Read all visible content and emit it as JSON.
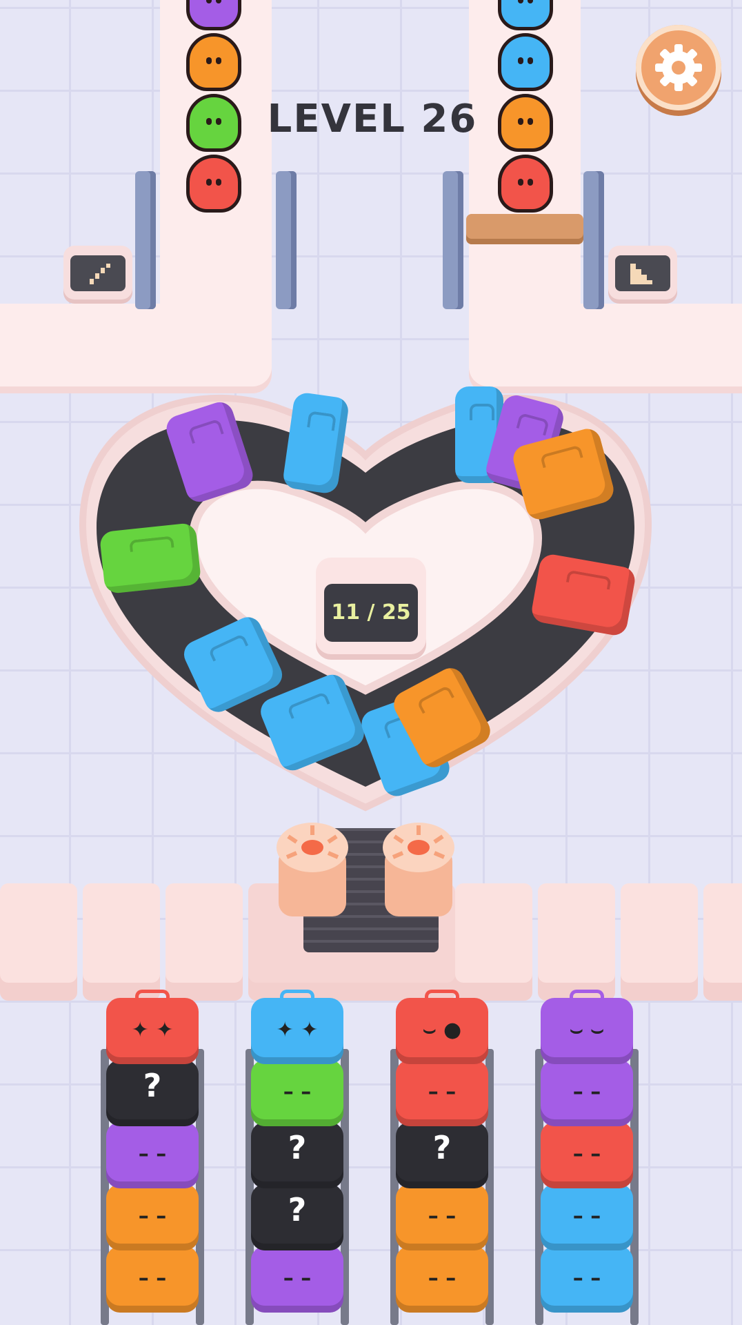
{
  "hud": {
    "level_title": "LEVEL 26",
    "settings_icon": "gear-icon"
  },
  "carousel": {
    "shape": "heart",
    "progress_text": "11 / 25",
    "progress": {
      "current": 11,
      "total": 25
    },
    "bags_on_belt": [
      "purple",
      "blue",
      "blue",
      "purple",
      "orange",
      "green",
      "red",
      "blue",
      "blue",
      "blue",
      "orange"
    ]
  },
  "queues": {
    "left": [
      "purple",
      "orange",
      "green",
      "red"
    ],
    "right": [
      "blue",
      "blue",
      "orange",
      "red"
    ]
  },
  "lanes": [
    {
      "bags": [
        {
          "color": "red",
          "face": "angry"
        },
        {
          "color": "black",
          "face": "?"
        },
        {
          "color": "purple",
          "face": "– –"
        },
        {
          "color": "orange",
          "face": "– –"
        },
        {
          "color": "orange",
          "face": "– –"
        }
      ]
    },
    {
      "bags": [
        {
          "color": "blue",
          "face": "angry"
        },
        {
          "color": "green",
          "face": "– –"
        },
        {
          "color": "black",
          "face": "?"
        },
        {
          "color": "black",
          "face": "?"
        },
        {
          "color": "purple",
          "face": "– –"
        }
      ]
    },
    {
      "bags": [
        {
          "color": "red",
          "face": "wink"
        },
        {
          "color": "red",
          "face": "– –"
        },
        {
          "color": "black",
          "face": "?"
        },
        {
          "color": "orange",
          "face": "– –"
        },
        {
          "color": "orange",
          "face": "– –"
        }
      ]
    },
    {
      "bags": [
        {
          "color": "purple",
          "face": "smile"
        },
        {
          "color": "purple",
          "face": "– –"
        },
        {
          "color": "red",
          "face": "– –"
        },
        {
          "color": "blue",
          "face": "– –"
        },
        {
          "color": "blue",
          "face": "– –"
        }
      ]
    }
  ],
  "palette": {
    "red": "#f2544a",
    "blue": "#45b5f5",
    "green": "#66d43f",
    "purple": "#a45de6",
    "orange": "#f7952a",
    "black": "#2d2d33"
  }
}
